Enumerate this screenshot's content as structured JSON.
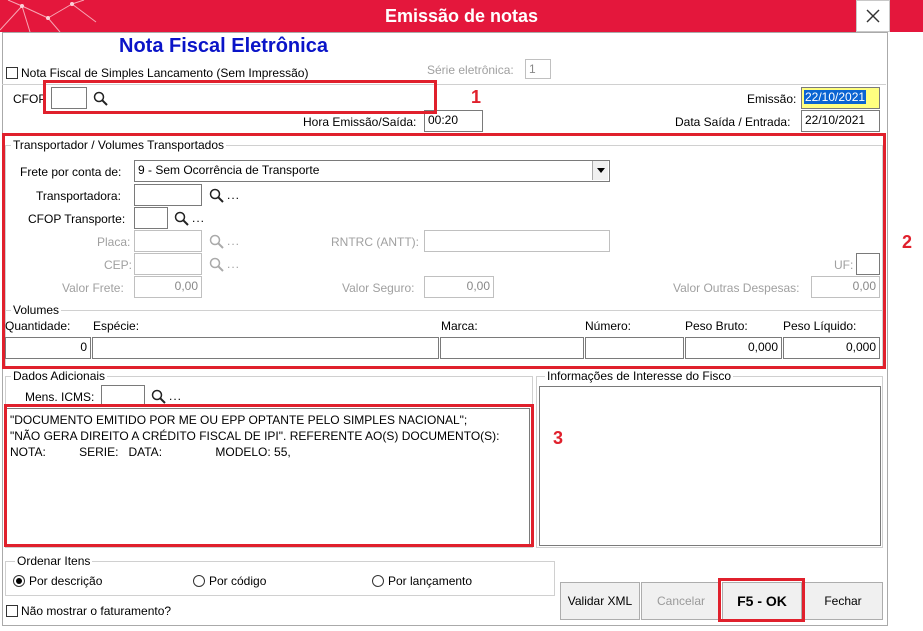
{
  "window": {
    "title": "Emissão de notas",
    "close_icon": "close-icon"
  },
  "header": {
    "nfe_title": "Nota Fiscal Eletrônica",
    "simple_launch_label": "Nota Fiscal de Simples Lancamento (Sem Impressão)",
    "serie_label": "Série eletrônica:",
    "serie_value": "1",
    "cfop_label": "CFOP",
    "cfop_value": "",
    "emissao_label": "Emissão:",
    "emissao_value": "22/10/2021",
    "hora_label": "Hora Emissão/Saída:",
    "hora_value": "00:20",
    "data_saida_label": "Data Saída / Entrada:",
    "data_saida_value": "22/10/2021"
  },
  "transport": {
    "group_title": "Transportador /  Volumes Transportados",
    "frete_label": "Frete por conta de:",
    "frete_value": "9 - Sem Ocorrência de Transporte",
    "transportadora_label": "Transportadora:",
    "cfop_transporte_label": "CFOP Transporte:",
    "placa_label": "Placa:",
    "rntrc_label": "RNTRC (ANTT):",
    "cep_label": "CEP:",
    "uf_label": "UF:",
    "valor_frete_label": "Valor Frete:",
    "valor_frete_value": "0,00",
    "valor_seguro_label": "Valor Seguro:",
    "valor_seguro_value": "0,00",
    "valor_outras_label": "Valor Outras Despesas:",
    "valor_outras_value": "0,00",
    "dots": "..."
  },
  "volumes": {
    "group_title": "Volumes",
    "headers": [
      "Quantidade:",
      "Espécie:",
      "Marca:",
      "Número:",
      "Peso Bruto:",
      "Peso Líquido:"
    ],
    "quantidade": "0",
    "especie": "",
    "marca": "",
    "numero": "",
    "peso_bruto": "0,000",
    "peso_liquido": "0,000"
  },
  "dados_adicionais": {
    "group_title": "Dados Adicionais",
    "mens_icms_label": "Mens. ICMS:",
    "text": "\"DOCUMENTO EMITIDO POR ME OU EPP OPTANTE PELO SIMPLES NACIONAL\";\n\"NÃO GERA DIREITO A CRÉDITO FISCAL DE IPI\". REFERENTE AO(S) DOCUMENTO(S):\nNOTA:          SERIE:   DATA:                MODELO: 55,"
  },
  "fisco": {
    "group_title": "Informações de Interesse do Fisco",
    "text": ""
  },
  "ordenar": {
    "group_title": "Ordenar Itens",
    "options": [
      "Por descrição",
      "Por código",
      "Por lançamento"
    ],
    "selected": "Por descrição"
  },
  "footer": {
    "nao_mostrar_label": "Não mostrar o faturamento?",
    "validar_label": "Validar XML",
    "cancelar_label": "Cancelar",
    "ok_label": "F5 - OK",
    "fechar_label": "Fechar"
  },
  "annotations": {
    "n1": "1",
    "n2": "2",
    "n3": "3"
  },
  "colors": {
    "titlebar": "#e4173c",
    "annotation_red": "#e0202c",
    "nfe_title_blue": "#0a14c8"
  }
}
